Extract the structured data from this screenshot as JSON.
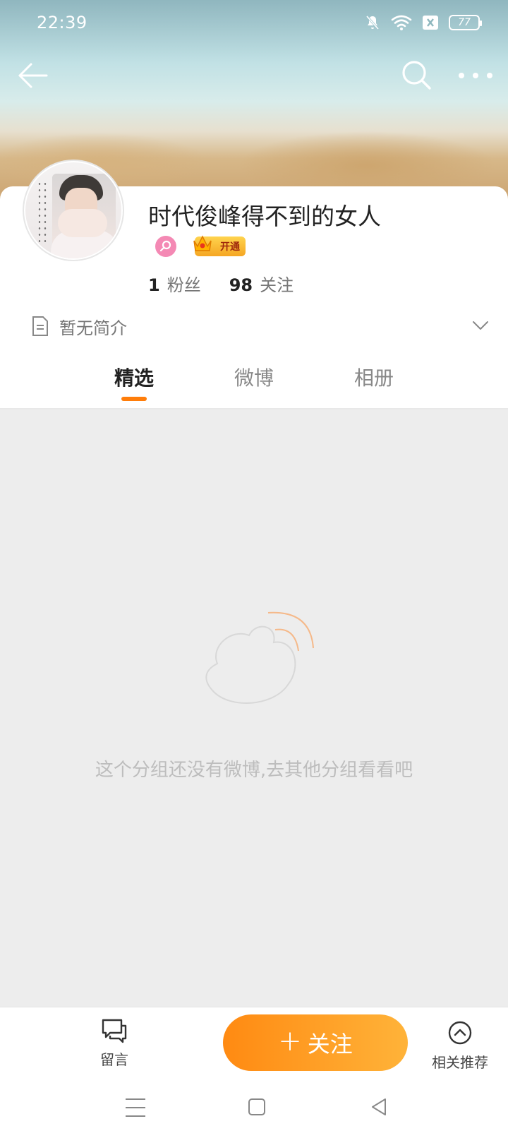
{
  "status_bar": {
    "time": "22:39",
    "battery": "77",
    "icons": [
      "mute-bell-icon",
      "wifi-icon",
      "sim-icon",
      "battery-icon"
    ]
  },
  "top_nav": {
    "back_icon": "arrow-left-icon",
    "search_icon": "search-icon",
    "more_icon": "more-dots-icon"
  },
  "profile": {
    "username": "时代俊峰得不到的女人",
    "vip_badge": "开通",
    "gender_color": "#f489b4",
    "followers_count": "1",
    "followers_label": "粉丝",
    "following_count": "98",
    "following_label": "关注",
    "bio": "暂无简介"
  },
  "tabs": [
    {
      "label": "精选",
      "active": true
    },
    {
      "label": "微博",
      "active": false
    },
    {
      "label": "相册",
      "active": false
    }
  ],
  "empty_state": {
    "message": "这个分组还没有微博,去其他分组看看吧"
  },
  "action_bar": {
    "message_label": "留言",
    "follow_plus": "+",
    "follow_label": "关注",
    "recommend_label": "相关推荐"
  },
  "colors": {
    "accent": "#ff7d0a",
    "follow_gradient_start": "#ff8a12",
    "follow_gradient_end": "#ffb339"
  }
}
